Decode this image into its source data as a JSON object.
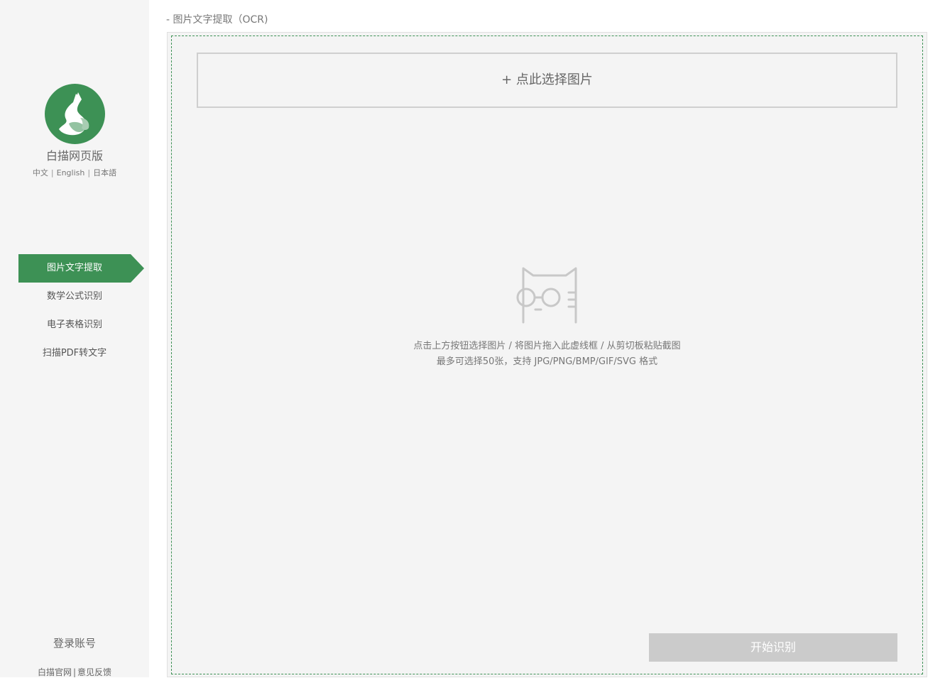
{
  "sidebar": {
    "app_name": "白描网页版",
    "languages": [
      "中文",
      "English",
      "日本語"
    ],
    "nav": [
      {
        "label": "图片文字提取",
        "active": true
      },
      {
        "label": "数学公式识别",
        "active": false
      },
      {
        "label": "电子表格识别",
        "active": false
      },
      {
        "label": "扫描PDF转文字",
        "active": false
      }
    ],
    "login_label": "登录账号",
    "footer": {
      "official_site": "白描官网",
      "separator": "|",
      "feedback": "意见反馈"
    }
  },
  "main": {
    "breadcrumb": "- 图片文字提取（OCR)",
    "select_button_label": "+ 点此选择图片",
    "hint_line1": "点击上方按钮选择图片 / 将图片拖入此虚线框 / 从剪切板粘贴截图",
    "hint_line2": "最多可选择50张，支持 JPG/PNG/BMP/GIF/SVG 格式",
    "start_button_label": "开始识别"
  },
  "colors": {
    "brand_green": "#3d9155",
    "disabled_button": "#cbcbcb",
    "panel_bg": "#f4f4f4",
    "sidebar_bg": "#f5f5f5"
  },
  "icons": [
    "app-logo-cat-icon",
    "cat-glasses-placeholder-icon"
  ]
}
